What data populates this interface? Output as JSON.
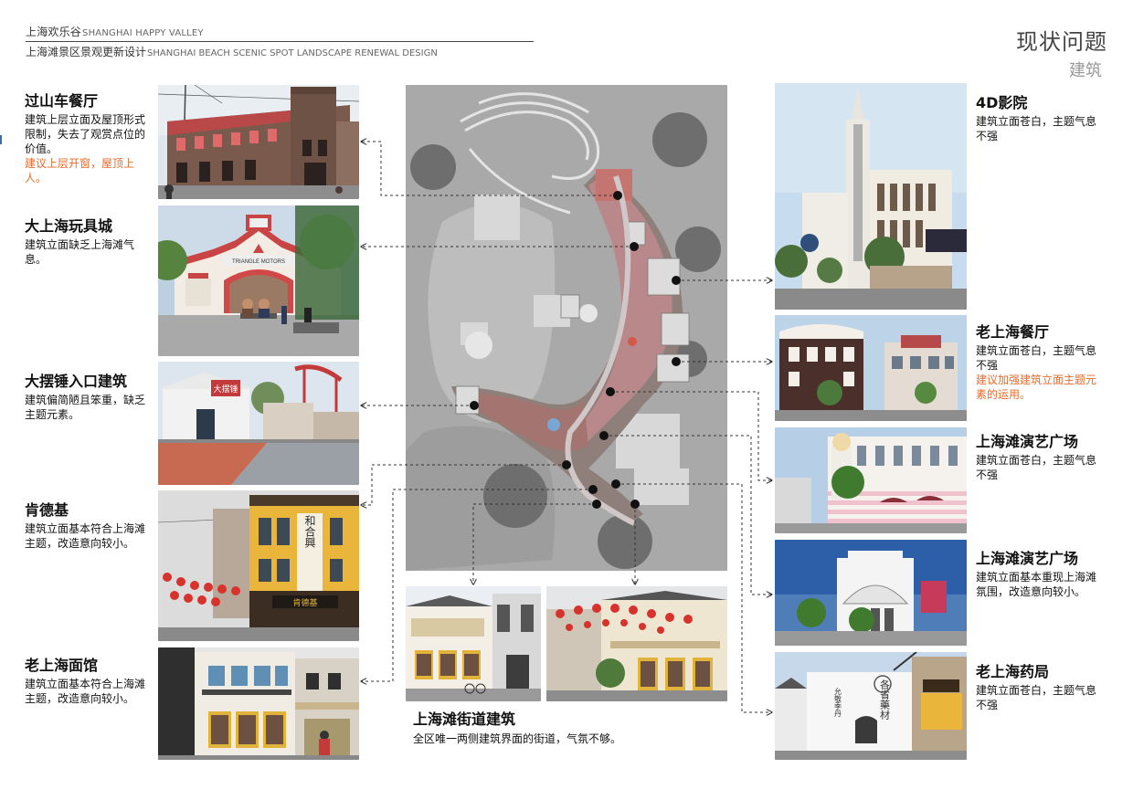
{
  "header": {
    "line1_cn": "上海欢乐谷",
    "line1_en": "SHANGHAI HAPPY VALLEY",
    "line2_cn": "上海滩景区景观更新设计",
    "line2_en": "SHANGHAI BEACH SCENIC SPOT LANDSCAPE RENEWAL DESIGN"
  },
  "page": {
    "title": "现状问题",
    "subtitle": "建筑"
  },
  "left_items": [
    {
      "title": "过山车餐厅",
      "desc": "建筑上层立面及屋顶形式限制，失去了观赏点位的价值。",
      "suggestion": "建议上层开窗，屋顶上人。"
    },
    {
      "title": "大上海玩具城",
      "desc": "建筑立面缺乏上海滩气息。",
      "suggestion": ""
    },
    {
      "title": "大摆锤入口建筑",
      "desc": "建筑偏简陋且笨重，缺乏主题元素。",
      "suggestion": ""
    },
    {
      "title": "肯德基",
      "desc": "建筑立面基本符合上海滩主题，改造意向较小。",
      "suggestion": ""
    },
    {
      "title": "老上海面馆",
      "desc": "建筑立面基本符合上海滩主题，改造意向较小。",
      "suggestion": ""
    }
  ],
  "right_items": [
    {
      "title": "4D影院",
      "desc": "建筑立面苍白，主题气息不强",
      "suggestion": ""
    },
    {
      "title": "老上海餐厅",
      "desc": "建筑立面苍白，主题气息不强",
      "suggestion": "建议加强建筑立面主题元素的运用。"
    },
    {
      "title": "上海滩演艺广场",
      "desc": "建筑立面苍白，主题气息不强",
      "suggestion": ""
    },
    {
      "title": "上海滩演艺广场",
      "desc": "建筑立面基本重现上海滩氛围，改造意向较小。",
      "suggestion": ""
    },
    {
      "title": "老上海药局",
      "desc": "建筑立面苍白，主题气息不强",
      "suggestion": ""
    }
  ],
  "bottom_item": {
    "title": "上海滩街道建筑",
    "desc": "全区唯一两侧建筑界面的街道，气氛不够。"
  },
  "signs": {
    "toy_city": "TRIANGLE MOTORS",
    "pendulum": "大摆锤",
    "kfc_vertical": "和合興",
    "kfc_shop": "肯德基",
    "pharmacy_left": "允敬季丹",
    "pharmacy_right": "各省藥材"
  },
  "colors": {
    "accent_orange": "#ea6a29",
    "marker": "#111111",
    "connector": "#333333"
  }
}
